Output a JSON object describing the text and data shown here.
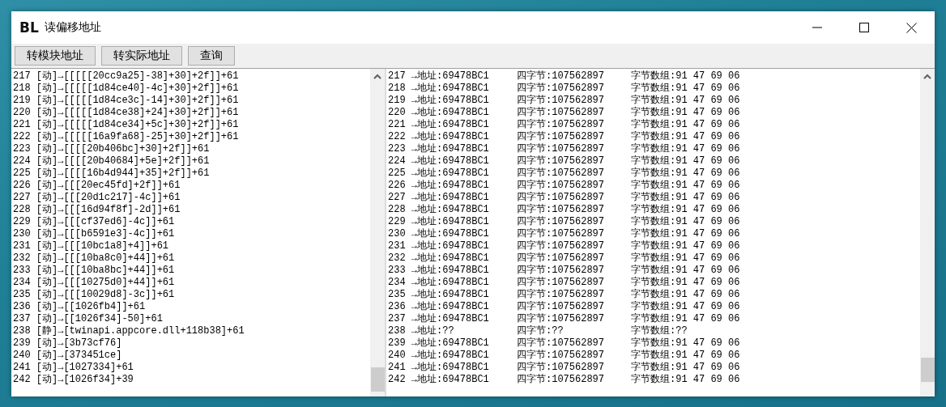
{
  "window": {
    "logo": "BL",
    "title": "读偏移地址"
  },
  "toolbar": {
    "buttons": [
      "转模块地址",
      "转实际地址",
      "查询"
    ]
  },
  "offset_list": {
    "rows": [
      "217 [动]→[[[[[20cc9a25]-38]+30]+2f]]+61",
      "218 [动]→[[[[[1d84ce40]-4c]+30]+2f]]+61",
      "219 [动]→[[[[[1d84ce3c]-14]+30]+2f]]+61",
      "220 [动]→[[[[[1d84ce38]+24]+30]+2f]]+61",
      "221 [动]→[[[[[1d84ce34]+5c]+30]+2f]]+61",
      "222 [动]→[[[[[16a9fa68]-25]+30]+2f]]+61",
      "223 [动]→[[[[20b406bc]+30]+2f]]+61",
      "224 [动]→[[[[20b40684]+5e]+2f]]+61",
      "225 [动]→[[[[16b4d944]+35]+2f]]+61",
      "226 [动]→[[[20ec45fd]+2f]]+61",
      "227 [动]→[[[20d1c217]-4c]]+61",
      "228 [动]→[[[16d94f8f]-2d]]+61",
      "229 [动]→[[[cf37ed6]-4c]]+61",
      "230 [动]→[[[b6591e3]-4c]]+61",
      "231 [动]→[[[10bc1a8]+4]]+61",
      "232 [动]→[[[10ba8c0]+44]]+61",
      "233 [动]→[[[10ba8bc]+44]]+61",
      "234 [动]→[[[10275d0]+44]]+61",
      "235 [动]→[[[10029d8]-3c]]+61",
      "236 [动]→[[1026fb4]]+61",
      "237 [动]→[[1026f34]-50]+61",
      "238 [静]→[twinapi.appcore.dll+118b38]+61",
      "239 [动]→[3b73cf76]",
      "240 [动]→[373451ce]",
      "241 [动]→[1027334]+61",
      "242 [动]→[1026f34]+39"
    ]
  },
  "value_list": {
    "rows": [
      {
        "address": "217 →地址:69478BC1",
        "dword": "四字节:107562897",
        "bytes": "字节数组:91 47 69 06"
      },
      {
        "address": "218 →地址:69478BC1",
        "dword": "四字节:107562897",
        "bytes": "字节数组:91 47 69 06"
      },
      {
        "address": "219 →地址:69478BC1",
        "dword": "四字节:107562897",
        "bytes": "字节数组:91 47 69 06"
      },
      {
        "address": "220 →地址:69478BC1",
        "dword": "四字节:107562897",
        "bytes": "字节数组:91 47 69 06"
      },
      {
        "address": "221 →地址:69478BC1",
        "dword": "四字节:107562897",
        "bytes": "字节数组:91 47 69 06"
      },
      {
        "address": "222 →地址:69478BC1",
        "dword": "四字节:107562897",
        "bytes": "字节数组:91 47 69 06"
      },
      {
        "address": "223 →地址:69478BC1",
        "dword": "四字节:107562897",
        "bytes": "字节数组:91 47 69 06"
      },
      {
        "address": "224 →地址:69478BC1",
        "dword": "四字节:107562897",
        "bytes": "字节数组:91 47 69 06"
      },
      {
        "address": "225 →地址:69478BC1",
        "dword": "四字节:107562897",
        "bytes": "字节数组:91 47 69 06"
      },
      {
        "address": "226 →地址:69478BC1",
        "dword": "四字节:107562897",
        "bytes": "字节数组:91 47 69 06"
      },
      {
        "address": "227 →地址:69478BC1",
        "dword": "四字节:107562897",
        "bytes": "字节数组:91 47 69 06"
      },
      {
        "address": "228 →地址:69478BC1",
        "dword": "四字节:107562897",
        "bytes": "字节数组:91 47 69 06"
      },
      {
        "address": "229 →地址:69478BC1",
        "dword": "四字节:107562897",
        "bytes": "字节数组:91 47 69 06"
      },
      {
        "address": "230 →地址:69478BC1",
        "dword": "四字节:107562897",
        "bytes": "字节数组:91 47 69 06"
      },
      {
        "address": "231 →地址:69478BC1",
        "dword": "四字节:107562897",
        "bytes": "字节数组:91 47 69 06"
      },
      {
        "address": "232 →地址:69478BC1",
        "dword": "四字节:107562897",
        "bytes": "字节数组:91 47 69 06"
      },
      {
        "address": "233 →地址:69478BC1",
        "dword": "四字节:107562897",
        "bytes": "字节数组:91 47 69 06"
      },
      {
        "address": "234 →地址:69478BC1",
        "dword": "四字节:107562897",
        "bytes": "字节数组:91 47 69 06"
      },
      {
        "address": "235 →地址:69478BC1",
        "dword": "四字节:107562897",
        "bytes": "字节数组:91 47 69 06"
      },
      {
        "address": "236 →地址:69478BC1",
        "dword": "四字节:107562897",
        "bytes": "字节数组:91 47 69 06"
      },
      {
        "address": "237 →地址:69478BC1",
        "dword": "四字节:107562897",
        "bytes": "字节数组:91 47 69 06"
      },
      {
        "address": "238 →地址:??",
        "dword": "四字节:??",
        "bytes": "字节数组:??"
      },
      {
        "address": "239 →地址:69478BC1",
        "dword": "四字节:107562897",
        "bytes": "字节数组:91 47 69 06"
      },
      {
        "address": "240 →地址:69478BC1",
        "dword": "四字节:107562897",
        "bytes": "字节数组:91 47 69 06"
      },
      {
        "address": "241 →地址:69478BC1",
        "dword": "四字节:107562897",
        "bytes": "字节数组:91 47 69 06"
      },
      {
        "address": "242 →地址:69478BC1",
        "dword": "四字节:107562897",
        "bytes": "字节数组:91 47 69 06"
      }
    ]
  }
}
